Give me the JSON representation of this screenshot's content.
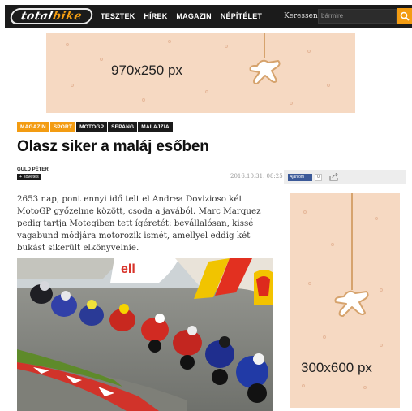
{
  "header": {
    "logo_text": "totalbike",
    "logo_text_a": "total",
    "logo_text_b": "bike",
    "nav": [
      "TESZTEK",
      "HÍREK",
      "MAGAZIN",
      "NÉPÍTÉLET"
    ],
    "search_label": "Keressen",
    "search_placeholder": "bármire"
  },
  "ads": {
    "top_label": "970x250 px",
    "side_label": "300x600 px"
  },
  "article": {
    "tags": [
      "MAGAZIN",
      "SPORT",
      "MOTOGP",
      "SEPANG",
      "MALAJZIA"
    ],
    "title": "Olasz siker a maláj esőben",
    "author": "GULD PÉTER",
    "follow_label": "+ követés",
    "date": "2016.10.31. 08:25",
    "lead": "2653 nap, pont ennyi idő telt el Andrea Dovizioso két MotoGP győzelme között, csoda a javából. Marc Marquez pedig tartja Motegiben tett ígéretét: bevállalósan, kissé vagabund módjára motorozik ismét, amellyel eddig két bukást sikerült elkönyvelnie."
  },
  "social": {
    "fb_label": "Ajánlom",
    "fb_count": "0"
  },
  "colors": {
    "accent": "#f39c12",
    "header_bg": "#1b1b1b",
    "ad_bg": "#f6d9c2"
  }
}
